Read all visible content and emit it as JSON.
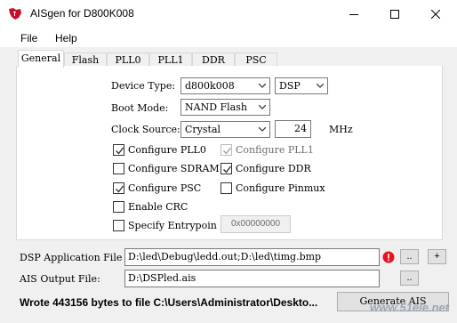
{
  "window": {
    "title": "AISgen for D800K008"
  },
  "menu": {
    "file": "File",
    "help": "Help"
  },
  "tabs": [
    "General",
    "Flash",
    "PLL0",
    "PLL1",
    "DDR",
    "PSC"
  ],
  "general": {
    "device_type_label": "Device Type:",
    "device_type_value": "d800k008",
    "core_value": "DSP",
    "boot_mode_label": "Boot Mode:",
    "boot_mode_value": "NAND Flash",
    "clock_source_label": "Clock Source:",
    "clock_source_value": "Crystal",
    "clock_freq_value": "24",
    "clock_unit": "MHz",
    "checkboxes": [
      {
        "label": "Configure PLL0",
        "checked": true,
        "enabled": true
      },
      {
        "label": "Configure PLL1",
        "checked": true,
        "enabled": false
      },
      {
        "label": "Configure SDRAM",
        "checked": false,
        "enabled": true
      },
      {
        "label": "Configure DDR",
        "checked": true,
        "enabled": true
      },
      {
        "label": "Configure PSC",
        "checked": true,
        "enabled": true
      },
      {
        "label": "Configure Pinmux",
        "checked": false,
        "enabled": true
      },
      {
        "label": "Enable CRC",
        "checked": false,
        "enabled": true
      },
      {
        "label": "Specify Entrypoin",
        "checked": false,
        "enabled": true
      }
    ],
    "entrypoint_value": "0x00000000"
  },
  "files": {
    "app_file_label": "DSP Application File",
    "app_file_value": "D:\\led\\Debug\\ledd.out;D:\\led\\timg.bmp",
    "browse_label": "..",
    "add_label": "+",
    "ais_output_label": "AIS Output File:",
    "ais_output_value": "D:\\DSPled.ais",
    "browse2_label": ".."
  },
  "status_text": "Wrote 443156 bytes to file C:\\Users\\Administrator\\Deskto...",
  "generate_button": "Generate AIS",
  "watermark": "www.51ele.net",
  "colors": {
    "accent": "#c8102e",
    "error": "#e81123"
  }
}
